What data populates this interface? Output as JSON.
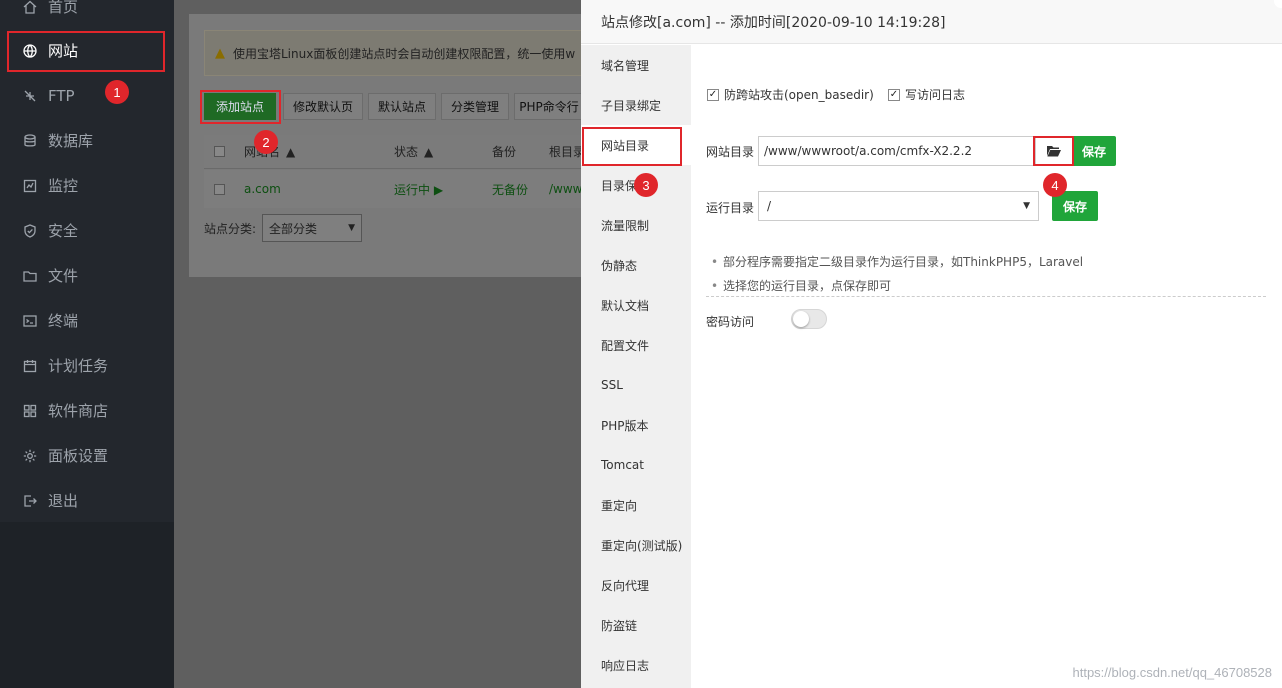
{
  "sidebar": {
    "items": [
      {
        "label": "首页",
        "icon": "home-icon"
      },
      {
        "label": "网站",
        "icon": "globe-icon"
      },
      {
        "label": "FTP",
        "icon": "ftp-icon"
      },
      {
        "label": "数据库",
        "icon": "database-icon"
      },
      {
        "label": "监控",
        "icon": "monitor-icon"
      },
      {
        "label": "安全",
        "icon": "shield-icon"
      },
      {
        "label": "文件",
        "icon": "folder-icon"
      },
      {
        "label": "终端",
        "icon": "terminal-icon"
      },
      {
        "label": "计划任务",
        "icon": "calendar-icon"
      },
      {
        "label": "软件商店",
        "icon": "grid-icon"
      },
      {
        "label": "面板设置",
        "icon": "gear-icon"
      },
      {
        "label": "退出",
        "icon": "logout-icon"
      }
    ]
  },
  "main": {
    "notice": "使用宝塔Linux面板创建站点时会自动创建权限配置，统一使用w",
    "buttons": [
      "添加站点",
      "修改默认页",
      "默认站点",
      "分类管理",
      "PHP命令行"
    ],
    "table": {
      "headers": [
        "网站名",
        "状态",
        "备份",
        "根目录"
      ],
      "rows": [
        {
          "name": "a.com",
          "status": "运行中 ▶",
          "backup": "无备份",
          "root": "/www"
        }
      ]
    },
    "category_label": "站点分类:",
    "category_value": "全部分类"
  },
  "dialog": {
    "title": "站点修改[a.com] -- 添加时间[2020-09-10 14:19:28]",
    "tabs": [
      "域名管理",
      "子目录绑定",
      "网站目录",
      "目录保护",
      "流量限制",
      "伪静态",
      "默认文档",
      "配置文件",
      "SSL",
      "PHP版本",
      "Tomcat",
      "重定向",
      "重定向(测试版)",
      "反向代理",
      "防盗链",
      "响应日志"
    ],
    "active_tab": "网站目录",
    "checkbox_anti_xss": "防跨站攻击(open_basedir)",
    "checkbox_access_log": "写访问日志",
    "site_dir_label": "网站目录",
    "site_dir_value": "/www/wwwroot/a.com/cmfx-X2.2.2",
    "save_label": "保存",
    "run_dir_label": "运行目录",
    "run_dir_value": "/",
    "tips": [
      "部分程序需要指定二级目录作为运行目录，如ThinkPHP5，Laravel",
      "选择您的运行目录，点保存即可"
    ],
    "password_access_label": "密码访问"
  },
  "annotations": [
    "1",
    "2",
    "3",
    "4"
  ],
  "watermark": "https://blog.csdn.net/qq_46708528",
  "colors": {
    "accent_green": "#20a53a",
    "annotation_red": "#e0262b",
    "sidebar_bg": "#23272d"
  }
}
